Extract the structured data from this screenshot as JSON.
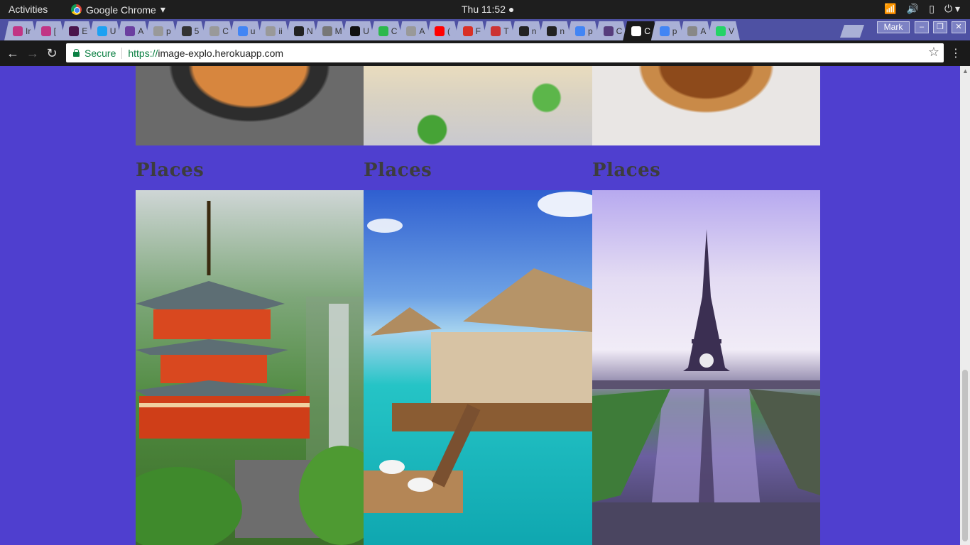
{
  "system": {
    "activities": "Activities",
    "app_name": "Google Chrome",
    "clock": "Thu 11:52 ●",
    "tray": [
      "wifi-icon",
      "volume-icon",
      "battery-icon",
      "power-icon"
    ]
  },
  "tabs": [
    {
      "label": "Ir",
      "color": "#c13584"
    },
    {
      "label": "[",
      "color": "#c13584"
    },
    {
      "label": "E",
      "color": "#4a154b"
    },
    {
      "label": "U",
      "color": "#1da1f2"
    },
    {
      "label": "A",
      "color": "#6b3fa0"
    },
    {
      "label": "p",
      "color": "#999999"
    },
    {
      "label": "5",
      "color": "#333333"
    },
    {
      "label": "C",
      "color": "#999999"
    },
    {
      "label": "u",
      "color": "#4285f4"
    },
    {
      "label": "ii",
      "color": "#999999"
    },
    {
      "label": "N",
      "color": "#222222"
    },
    {
      "label": "M",
      "color": "#777777"
    },
    {
      "label": "U",
      "color": "#111111"
    },
    {
      "label": "C",
      "color": "#2db84d"
    },
    {
      "label": "A",
      "color": "#999999"
    },
    {
      "label": "(",
      "color": "#ff0000"
    },
    {
      "label": "F",
      "color": "#d93025"
    },
    {
      "label": "T",
      "color": "#cc3333"
    },
    {
      "label": "n",
      "color": "#222222"
    },
    {
      "label": "n",
      "color": "#222222"
    },
    {
      "label": "p",
      "color": "#4285f4"
    },
    {
      "label": "C",
      "color": "#563d7c"
    },
    {
      "label": "C",
      "color": "#ffffff",
      "active": true
    },
    {
      "label": "p",
      "color": "#4285f4"
    },
    {
      "label": "A",
      "color": "#888888"
    },
    {
      "label": "V",
      "color": "#25d366"
    }
  ],
  "window": {
    "profile": "Mark",
    "minimize": "–",
    "restore": "❐",
    "close": "✕"
  },
  "toolbar": {
    "back": "←",
    "forward": "→",
    "reload": "↻",
    "secure_label": "Secure",
    "url_scheme": "https://",
    "url_host": "image-explo.herokuapp.com",
    "bookmark": "☆",
    "menu": "⋮"
  },
  "page": {
    "sections": [
      {
        "title": "Places"
      },
      {
        "title": "Places"
      },
      {
        "title": "Places"
      }
    ]
  }
}
